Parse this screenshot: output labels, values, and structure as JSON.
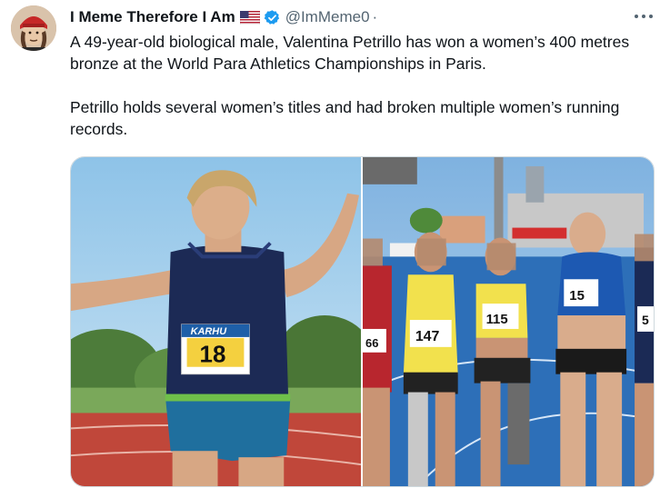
{
  "tweet": {
    "author": {
      "display_name": "I Meme Therefore I Am",
      "flag_icon": "us-flag-icon",
      "verified_icon": "verified-badge-icon",
      "handle": "@ImMeme0",
      "separator": "·"
    },
    "text_paragraph_1": "A 49-year-old biological male, Valentina Petrillo has won a women’s 400 metres bronze at the World Para Athletics Championships in Paris.",
    "text_paragraph_2": "Petrillo holds several women’s titles and had broken multiple women’s running records.",
    "more_icon": "more-options-icon",
    "media": {
      "left_photo": {
        "bib_brand": "KARHU",
        "bib_number": "18"
      },
      "right_photo": {
        "bibs": [
          "66",
          "147",
          "115",
          "15",
          "5"
        ]
      }
    }
  },
  "colors": {
    "text_primary": "#0f1419",
    "text_secondary": "#536471",
    "verified_blue": "#1d9bf0",
    "border": "#cfd9de",
    "track_red": "#c0473a",
    "track_blue": "#2d6fb8"
  }
}
